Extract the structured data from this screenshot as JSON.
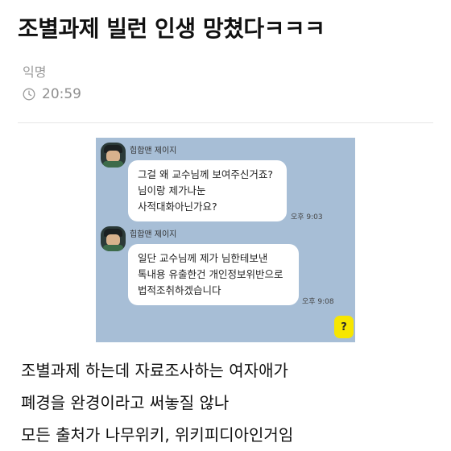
{
  "post": {
    "title": "조별과제 빌런 인생 망쳤다ㅋㅋㅋ",
    "author": "익명",
    "time": "20:59",
    "time_icon": "clock-icon"
  },
  "chat_capture": {
    "background": "#a7bed6",
    "messages": [
      {
        "sender": "힙합맨 제이지",
        "lines": [
          "그걸 왜 교수님께 보여주신거죠?",
          "님이랑 제가나눈",
          "사적대화아닌가요?"
        ],
        "time": "오후 9:03"
      },
      {
        "sender": "힙합맨 제이지",
        "lines": [
          "일단 교수님께 제가 님한테보낸",
          "톡내용 유출한건 개인정보위반으로",
          "법적조취하겠습니다"
        ],
        "time": "오후 9:08"
      }
    ],
    "help_button": "?"
  },
  "body": {
    "paragraphs": [
      "조별과제 하는데 자료조사하는 여자애가",
      "폐경을 완경이라고 써놓질 않나",
      "모든 출처가 나무위키, 위키피디아인거임"
    ]
  }
}
